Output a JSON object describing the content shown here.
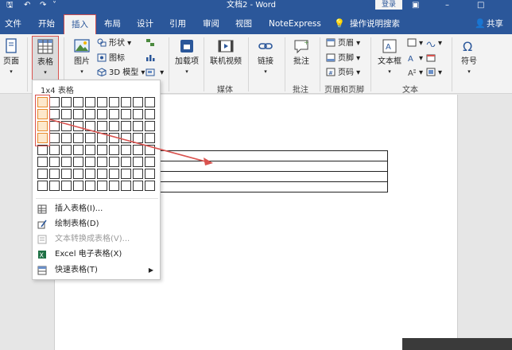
{
  "window": {
    "title": "文档2 - Word",
    "login_label": "登录"
  },
  "tabs": [
    {
      "label": "文件"
    },
    {
      "label": "开始"
    },
    {
      "label": "插入"
    },
    {
      "label": "布局"
    },
    {
      "label": "设计"
    },
    {
      "label": "引用"
    },
    {
      "label": "审阅"
    },
    {
      "label": "视图"
    },
    {
      "label": "NoteExpress"
    },
    {
      "label": "操作说明搜索"
    },
    {
      "label": "共享"
    }
  ],
  "ribbon": {
    "page_label": "页面",
    "table_label": "表格",
    "picture_label": "图片",
    "shapes_label": "形状",
    "icons_label": "图标",
    "model3d_label": "3D 模型",
    "addins_label": "加载项",
    "online_video_label": "联机视频",
    "link_label": "链接",
    "comment_label": "批注",
    "header_label": "页眉",
    "footer_label": "页脚",
    "page_number_label": "页码",
    "textbox_label": "文本框",
    "symbol_label": "符号",
    "group_media": "媒体",
    "group_comments": "批注",
    "group_header_footer": "页眉和页脚",
    "group_text": "文本"
  },
  "table_menu": {
    "grid_label": "1x4 表格",
    "selected_cols": 1,
    "selected_rows": 4,
    "grid_cols": 10,
    "grid_rows": 8,
    "items": [
      {
        "label": "插入表格(I)...",
        "icon": "insert-table-icon",
        "enabled": true
      },
      {
        "label": "绘制表格(D)",
        "icon": "draw-table-icon",
        "enabled": true
      },
      {
        "label": "文本转换成表格(V)...",
        "icon": "convert-text-icon",
        "enabled": false
      },
      {
        "label": "Excel 电子表格(X)",
        "icon": "excel-icon",
        "enabled": true
      },
      {
        "label": "快速表格(T)",
        "icon": "quick-table-icon",
        "enabled": true
      }
    ]
  },
  "document": {
    "table_rows": 4,
    "table_cols": 1
  },
  "colors": {
    "accent": "#2b579a",
    "selection": "#e88a2a",
    "annotation": "#d9534f"
  }
}
